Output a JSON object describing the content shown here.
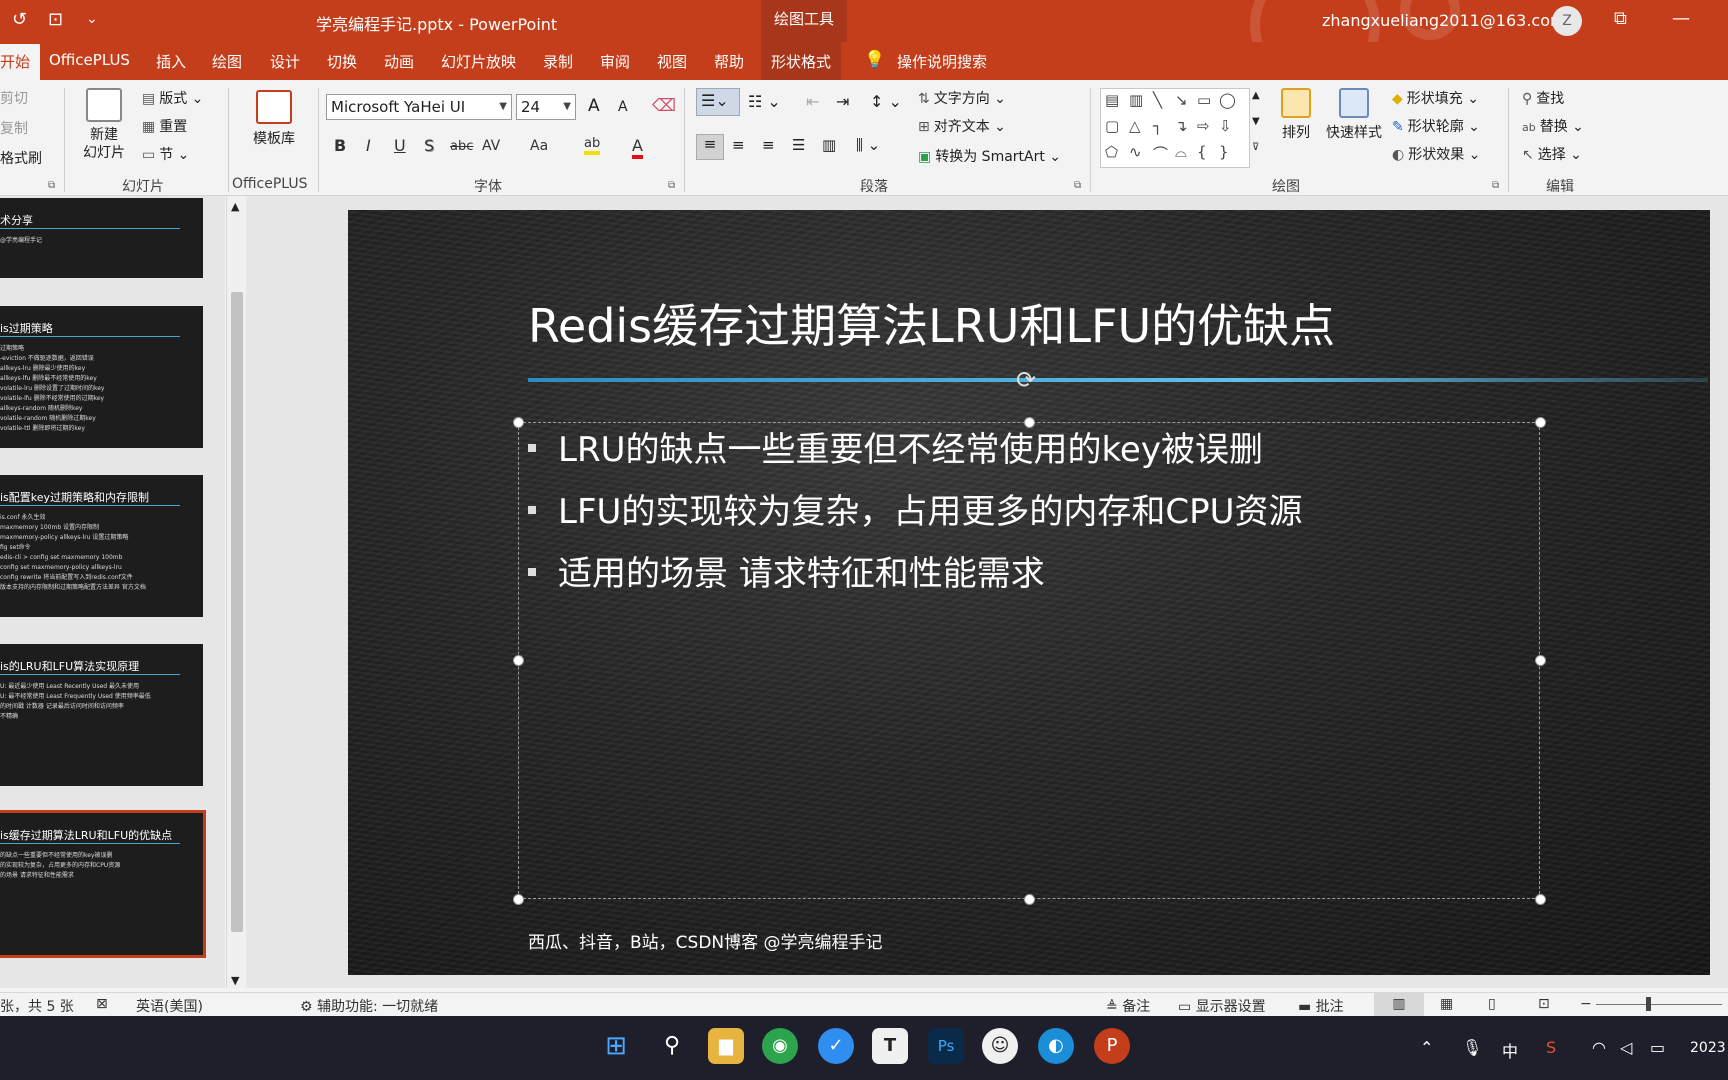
{
  "titlebar": {
    "file_title": "学亮编程手记.pptx  -  PowerPoint",
    "context_tab": "绘图工具",
    "account": "zhangxueliang2011@163.com",
    "avatar_letter": "Z",
    "undo_glyph": "↺",
    "present_glyph": "⊡",
    "customize_glyph": "⌄",
    "restore_glyph": "⧉",
    "minimize_glyph": "—"
  },
  "tabs": {
    "home": "开始",
    "officeplus": "OfficePLUS",
    "insert": "插入",
    "draw": "绘图",
    "design": "设计",
    "transitions": "切换",
    "animations": "动画",
    "slideshow": "幻灯片放映",
    "record": "录制",
    "review": "审阅",
    "view": "视图",
    "help": "帮助",
    "shape_format": "形状格式",
    "search": "操作说明搜索"
  },
  "ribbon": {
    "clipboard": {
      "cut": "剪切",
      "copy": "复制",
      "painter": "格式刷"
    },
    "slides": {
      "new_slide": "新建\n幻灯片",
      "layout": "版式",
      "reset": "重置",
      "section": "节",
      "group": "幻灯片"
    },
    "officeplus": {
      "template": "模板库",
      "group": "OfficePLUS"
    },
    "font": {
      "name": "Microsoft YaHei UI",
      "size": "24",
      "group": "字体",
      "bold": "B",
      "italic": "I",
      "underline": "U",
      "shadow": "S",
      "strike": "abc",
      "spacing": "AV",
      "case": "Aa",
      "color": "A",
      "grow": "A",
      "shrink": "A"
    },
    "paragraph": {
      "text_direction": "文字方向",
      "align_text": "对齐文本",
      "smartart": "转换为 SmartArt",
      "group": "段落"
    },
    "drawing": {
      "arrange": "排列",
      "quick_styles": "快速样式",
      "fill": "形状填充",
      "outline": "形状轮廓",
      "effects": "形状效果",
      "group": "绘图"
    },
    "editing": {
      "find": "查找",
      "replace": "替换",
      "select": "选择",
      "group": "编辑"
    }
  },
  "thumbnails": [
    {
      "title": "术分享",
      "lines": [
        "@学亮编程手记"
      ]
    },
    {
      "title": "is过期策略",
      "lines": [
        "过期策略",
        "-eviction 不做驱逐数据，返回错误",
        "allkeys-lru 删除最少使用的key",
        "allkeys-lfu 删除最不经常使用的key",
        "volatile-lru 删除设置了过期时间的key",
        "volatile-lfu 删除不经常使用的过期key",
        "allkeys-random 随机删除key",
        "volatile-random 随机删除过期key",
        "volatile-ttl 删除即将过期的key"
      ]
    },
    {
      "title": "is配置key过期策略和内存限制",
      "lines": [
        "is.conf 永久生效",
        "maxmemory 100mb 设置内存限制",
        "maxmemory-policy allkeys-lru 设置过期策略",
        "",
        "fig set命令",
        "edis-cli > config set maxmemory 100mb",
        "config set maxmemory-policy allkeys-lru",
        "config rewrite 将当前配置写入到redis.conf文件",
        "",
        "版本支持的内存限制和过期策略配置方法差异  官方文档"
      ]
    },
    {
      "title": "is的LRU和LFU算法实现原理",
      "lines": [
        "U: 最近最少使用 Least Recently Used 最久未使用",
        "U: 最不经常使用 Least Frequently Used 使用频率最低",
        "的时间戳  计数器 记录最后访问时间和访问频率",
        "不精确"
      ]
    },
    {
      "title": "is缓存过期算法LRU和LFU的优缺点",
      "lines": [
        "的缺点一些重要但不经常使用的key被误删",
        "的实现较为复杂，占用更多的内存和CPU资源",
        "的场景  请求特征和性能需求"
      ]
    }
  ],
  "slide": {
    "title": "Redis缓存过期算法LRU和LFU的优缺点",
    "bullets": [
      "LRU的缺点一些重要但不经常使用的key被误删",
      "LFU的实现较为复杂，占用更多的内存和CPU资源",
      "适用的场景  请求特征和性能需求"
    ],
    "footer": "西瓜、抖音，B站，CSDN博客  @学亮编程手记"
  },
  "status": {
    "slide_count": "张，共 5 张",
    "language": "英语(美国)",
    "accessibility": "辅助功能: 一切就绪",
    "notes": "备注",
    "display": "显示器设置",
    "comments": "批注"
  },
  "taskbar": {
    "year": "2023",
    "ime": "中"
  },
  "colors": {
    "accent": "#c43e1c",
    "title_line": "#5fc0ea",
    "slide_bg": "#222222"
  }
}
